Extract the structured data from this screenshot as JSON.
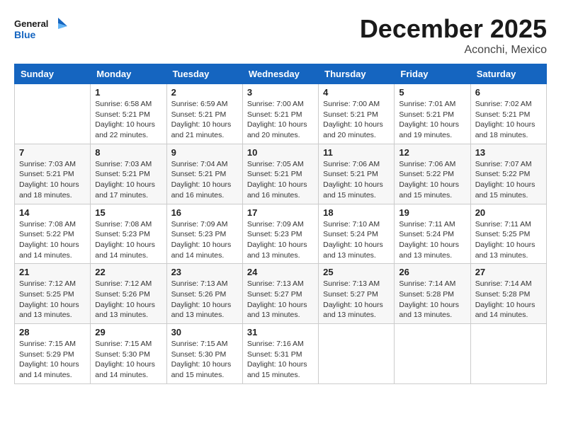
{
  "logo": {
    "line1": "General",
    "line2": "Blue"
  },
  "title": "December 2025",
  "location": "Aconchi, Mexico",
  "days_of_week": [
    "Sunday",
    "Monday",
    "Tuesday",
    "Wednesday",
    "Thursday",
    "Friday",
    "Saturday"
  ],
  "weeks": [
    [
      {
        "day": "",
        "info": ""
      },
      {
        "day": "1",
        "info": "Sunrise: 6:58 AM\nSunset: 5:21 PM\nDaylight: 10 hours\nand 22 minutes."
      },
      {
        "day": "2",
        "info": "Sunrise: 6:59 AM\nSunset: 5:21 PM\nDaylight: 10 hours\nand 21 minutes."
      },
      {
        "day": "3",
        "info": "Sunrise: 7:00 AM\nSunset: 5:21 PM\nDaylight: 10 hours\nand 20 minutes."
      },
      {
        "day": "4",
        "info": "Sunrise: 7:00 AM\nSunset: 5:21 PM\nDaylight: 10 hours\nand 20 minutes."
      },
      {
        "day": "5",
        "info": "Sunrise: 7:01 AM\nSunset: 5:21 PM\nDaylight: 10 hours\nand 19 minutes."
      },
      {
        "day": "6",
        "info": "Sunrise: 7:02 AM\nSunset: 5:21 PM\nDaylight: 10 hours\nand 18 minutes."
      }
    ],
    [
      {
        "day": "7",
        "info": "Sunrise: 7:03 AM\nSunset: 5:21 PM\nDaylight: 10 hours\nand 18 minutes."
      },
      {
        "day": "8",
        "info": "Sunrise: 7:03 AM\nSunset: 5:21 PM\nDaylight: 10 hours\nand 17 minutes."
      },
      {
        "day": "9",
        "info": "Sunrise: 7:04 AM\nSunset: 5:21 PM\nDaylight: 10 hours\nand 16 minutes."
      },
      {
        "day": "10",
        "info": "Sunrise: 7:05 AM\nSunset: 5:21 PM\nDaylight: 10 hours\nand 16 minutes."
      },
      {
        "day": "11",
        "info": "Sunrise: 7:06 AM\nSunset: 5:21 PM\nDaylight: 10 hours\nand 15 minutes."
      },
      {
        "day": "12",
        "info": "Sunrise: 7:06 AM\nSunset: 5:22 PM\nDaylight: 10 hours\nand 15 minutes."
      },
      {
        "day": "13",
        "info": "Sunrise: 7:07 AM\nSunset: 5:22 PM\nDaylight: 10 hours\nand 15 minutes."
      }
    ],
    [
      {
        "day": "14",
        "info": "Sunrise: 7:08 AM\nSunset: 5:22 PM\nDaylight: 10 hours\nand 14 minutes."
      },
      {
        "day": "15",
        "info": "Sunrise: 7:08 AM\nSunset: 5:23 PM\nDaylight: 10 hours\nand 14 minutes."
      },
      {
        "day": "16",
        "info": "Sunrise: 7:09 AM\nSunset: 5:23 PM\nDaylight: 10 hours\nand 14 minutes."
      },
      {
        "day": "17",
        "info": "Sunrise: 7:09 AM\nSunset: 5:23 PM\nDaylight: 10 hours\nand 13 minutes."
      },
      {
        "day": "18",
        "info": "Sunrise: 7:10 AM\nSunset: 5:24 PM\nDaylight: 10 hours\nand 13 minutes."
      },
      {
        "day": "19",
        "info": "Sunrise: 7:11 AM\nSunset: 5:24 PM\nDaylight: 10 hours\nand 13 minutes."
      },
      {
        "day": "20",
        "info": "Sunrise: 7:11 AM\nSunset: 5:25 PM\nDaylight: 10 hours\nand 13 minutes."
      }
    ],
    [
      {
        "day": "21",
        "info": "Sunrise: 7:12 AM\nSunset: 5:25 PM\nDaylight: 10 hours\nand 13 minutes."
      },
      {
        "day": "22",
        "info": "Sunrise: 7:12 AM\nSunset: 5:26 PM\nDaylight: 10 hours\nand 13 minutes."
      },
      {
        "day": "23",
        "info": "Sunrise: 7:13 AM\nSunset: 5:26 PM\nDaylight: 10 hours\nand 13 minutes."
      },
      {
        "day": "24",
        "info": "Sunrise: 7:13 AM\nSunset: 5:27 PM\nDaylight: 10 hours\nand 13 minutes."
      },
      {
        "day": "25",
        "info": "Sunrise: 7:13 AM\nSunset: 5:27 PM\nDaylight: 10 hours\nand 13 minutes."
      },
      {
        "day": "26",
        "info": "Sunrise: 7:14 AM\nSunset: 5:28 PM\nDaylight: 10 hours\nand 13 minutes."
      },
      {
        "day": "27",
        "info": "Sunrise: 7:14 AM\nSunset: 5:28 PM\nDaylight: 10 hours\nand 14 minutes."
      }
    ],
    [
      {
        "day": "28",
        "info": "Sunrise: 7:15 AM\nSunset: 5:29 PM\nDaylight: 10 hours\nand 14 minutes."
      },
      {
        "day": "29",
        "info": "Sunrise: 7:15 AM\nSunset: 5:30 PM\nDaylight: 10 hours\nand 14 minutes."
      },
      {
        "day": "30",
        "info": "Sunrise: 7:15 AM\nSunset: 5:30 PM\nDaylight: 10 hours\nand 15 minutes."
      },
      {
        "day": "31",
        "info": "Sunrise: 7:16 AM\nSunset: 5:31 PM\nDaylight: 10 hours\nand 15 minutes."
      },
      {
        "day": "",
        "info": ""
      },
      {
        "day": "",
        "info": ""
      },
      {
        "day": "",
        "info": ""
      }
    ]
  ]
}
